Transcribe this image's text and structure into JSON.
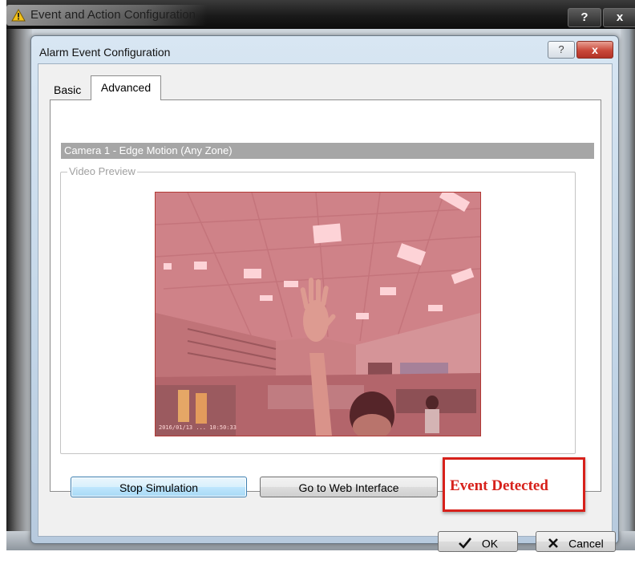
{
  "outer_window": {
    "title": "Event and Action Configuration",
    "help_label": "?",
    "close_label": "x"
  },
  "dialog": {
    "title": "Alarm Event Configuration",
    "help_label": "?",
    "close_label": "x"
  },
  "tabs": [
    {
      "label": "Basic",
      "selected": false
    },
    {
      "label": "Advanced",
      "selected": true
    }
  ],
  "panel": {
    "camera_title": "Camera 1 - Edge Motion (Any Zone)",
    "video_preview_label": "Video Preview",
    "video_timestamp": "2016/01/13 ... 10:50:33"
  },
  "buttons": {
    "stop_simulation": "Stop Simulation",
    "go_to_web": "Go to Web Interface",
    "ok": "OK",
    "cancel": "Cancel"
  },
  "status": {
    "event_text": "Event Detected",
    "event_color": "#d7211b"
  },
  "icons": {
    "warning": "warning-icon",
    "ok": "checkmark-icon",
    "cancel": "x-icon"
  }
}
